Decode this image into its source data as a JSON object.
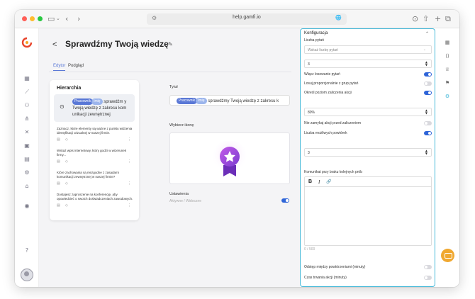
{
  "browser": {
    "url": "help.gamfi.io",
    "translate_icon": "🌐",
    "colors": {
      "close": "#ff5f57",
      "minimize": "#febc2e",
      "maximize": "#28c840"
    }
  },
  "header": {
    "back": "<",
    "title": "Sprawdźmy Twoją wiedzę",
    "tabs": [
      "Edytor",
      "Podgląd"
    ]
  },
  "hierarchy": {
    "title": "Hierarchia",
    "question": {
      "pill_a": "Pracownik",
      "pill_b": "Imię",
      "text_head": "sprawdźm",
      "text_tail": "y Twoją wiedzę z zakresu kom unikacji zewnętrznej"
    },
    "items": [
      "Zaznacz, które elementy są ważne z punktu widzenia identyfikacji wizualnej w naszej firmie.",
      "Wskaż wpis internetowy, który godzi w wizerunek firmy...",
      "Które zachowania są niezgodne z zasadami komunikacji zewnętrznej w naszej firmie?",
      "Dostajesz zaproszenie na konferencję, aby opowiedzieć o swoich doświadczeniach zawodowych."
    ]
  },
  "form": {
    "title_label": "Tytuł",
    "title_pill_a": "Pracownik",
    "title_pill_b": "Imię",
    "title_text": "sprawdźmy Twoją wiedzę z zakresu k",
    "icon_label": "Wybierz ikonę",
    "settings_label": "Ustawienia",
    "settings_value": "Aktywne / Widoczne",
    "settings_on": true
  },
  "config": {
    "title": "Konfiguracja",
    "question_count_label": "Liczba pytań",
    "question_count_placeholder": "Wskaż liczbę pytań",
    "count_value": "3",
    "random_label": "Włącz losowanie pytań",
    "proportional_label": "Losuj proporcjonalnie z grup pytań",
    "pass_label": "Określ poziom zaliczenia akcji",
    "pass_value": "80%",
    "noclose_label": "Nie zamykaj akcji przed zaliczeniem",
    "retries_label": "Liczba możliwych powtórek",
    "retries_value": "3",
    "message_label": "Komunikat przy braku kolejnych prób",
    "editor_bold": "B",
    "editor_italic": "I",
    "editor_link": "🔗",
    "char_count": "0 / 500",
    "interval_label": "Odstęp między powtórzeniami (minuty)",
    "duration_label": "Czas trwania akcji (minuty)"
  }
}
